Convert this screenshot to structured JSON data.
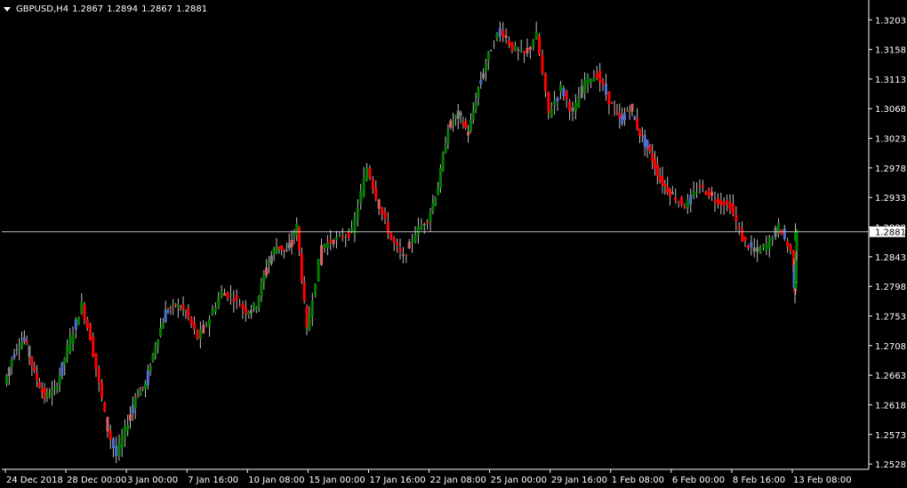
{
  "header": {
    "symbol": "GBPUSD,H4",
    "ohlc": [
      "1.2867",
      "1.2894",
      "1.2867",
      "1.2881"
    ]
  },
  "current_price_label": "1.2881",
  "colors": {
    "background": "#000000",
    "axis": "#ffffff",
    "bull_body": "#008000",
    "bear_body": "#ff0000",
    "wick": "#c0c0c0",
    "price_line": "#c0c0c0",
    "up_inside": "#4f6fd0",
    "down_inside": "#e06060",
    "neutral": "#808080"
  },
  "chart_data": {
    "type": "candlestick",
    "symbol": "GBPUSD",
    "timeframe": "H4",
    "last": {
      "open": 1.2867,
      "high": 1.2894,
      "low": 1.2867,
      "close": 1.2881
    },
    "ylim": [
      1.252,
      1.3225
    ],
    "y_ticks": [
      "1.3203",
      "1.3158",
      "1.3113",
      "1.3068",
      "1.3023",
      "1.2978",
      "1.2933",
      "1.2888",
      "1.2843",
      "1.2798",
      "1.2753",
      "1.2708",
      "1.2663",
      "1.2618",
      "1.2573",
      "1.2528"
    ],
    "x_ticks": [
      "24 Dec 2018",
      "28 Dec 00:00",
      "3 Jan 00:00",
      "7 Jan 16:00",
      "10 Jan 08:00",
      "15 Jan 00:00",
      "17 Jan 16:00",
      "22 Jan 08:00",
      "25 Jan 00:00",
      "29 Jan 16:00",
      "1 Feb 08:00",
      "6 Feb 00:00",
      "8 Feb 16:00",
      "13 Feb 08:00"
    ],
    "price_path": [
      [
        "24 Dec 2018",
        1.265
      ],
      [
        "",
        1.27
      ],
      [
        "",
        1.272
      ],
      [
        "",
        1.2665
      ],
      [
        "",
        1.263
      ],
      [
        "",
        1.264
      ],
      [
        "28 Dec 00:00",
        1.269
      ],
      [
        "",
        1.273
      ],
      [
        "",
        1.277
      ],
      [
        "",
        1.272
      ],
      [
        "",
        1.265
      ],
      [
        "",
        1.258
      ],
      [
        "",
        1.254
      ],
      [
        "3 Jan 00:00",
        1.258
      ],
      [
        "",
        1.263
      ],
      [
        "",
        1.265
      ],
      [
        "",
        1.271
      ],
      [
        "",
        1.276
      ],
      [
        "",
        1.277
      ],
      [
        "7 Jan 16:00",
        1.276
      ],
      [
        "",
        1.272
      ],
      [
        "",
        1.275
      ],
      [
        "",
        1.279
      ],
      [
        "",
        1.278
      ],
      [
        "10 Jan 08:00",
        1.276
      ],
      [
        "",
        1.277
      ],
      [
        "",
        1.283
      ],
      [
        "",
        1.286
      ],
      [
        "",
        1.285
      ],
      [
        "",
        1.289
      ],
      [
        "15 Jan 00:00",
        1.273
      ],
      [
        "",
        1.286
      ],
      [
        "",
        1.287
      ],
      [
        "",
        1.288
      ],
      [
        "17 Jan 16:00",
        1.298
      ],
      [
        "",
        1.292
      ],
      [
        "",
        1.287
      ],
      [
        "",
        1.284
      ],
      [
        "",
        1.288
      ],
      [
        "22 Jan 08:00",
        1.29
      ],
      [
        "",
        1.295
      ],
      [
        "",
        1.304
      ],
      [
        "",
        1.306
      ],
      [
        "",
        1.303
      ],
      [
        "",
        1.31
      ],
      [
        "25 Jan 00:00",
        1.315
      ],
      [
        "",
        1.319
      ],
      [
        "",
        1.316
      ],
      [
        "",
        1.315
      ],
      [
        "",
        1.318
      ],
      [
        "29 Jan 16:00",
        1.306
      ],
      [
        "",
        1.31
      ],
      [
        "",
        1.306
      ],
      [
        "",
        1.311
      ],
      [
        "",
        1.312
      ],
      [
        "1 Feb 08:00",
        1.308
      ],
      [
        "",
        1.305
      ],
      [
        "",
        1.307
      ],
      [
        "",
        1.303
      ],
      [
        "",
        1.3
      ],
      [
        "",
        1.296
      ],
      [
        "6 Feb 00:00",
        1.294
      ],
      [
        "",
        1.292
      ],
      [
        "",
        1.295
      ],
      [
        "",
        1.293
      ],
      [
        "8 Feb 16:00",
        1.292
      ],
      [
        "",
        1.287
      ],
      [
        "",
        1.285
      ],
      [
        "",
        1.286
      ],
      [
        "",
        1.289
      ],
      [
        "13 Feb 08:00",
        1.285
      ],
      [
        "",
        1.28
      ],
      [
        "",
        1.279
      ],
      [
        "",
        1.281
      ],
      [
        "",
        1.2881
      ]
    ]
  }
}
